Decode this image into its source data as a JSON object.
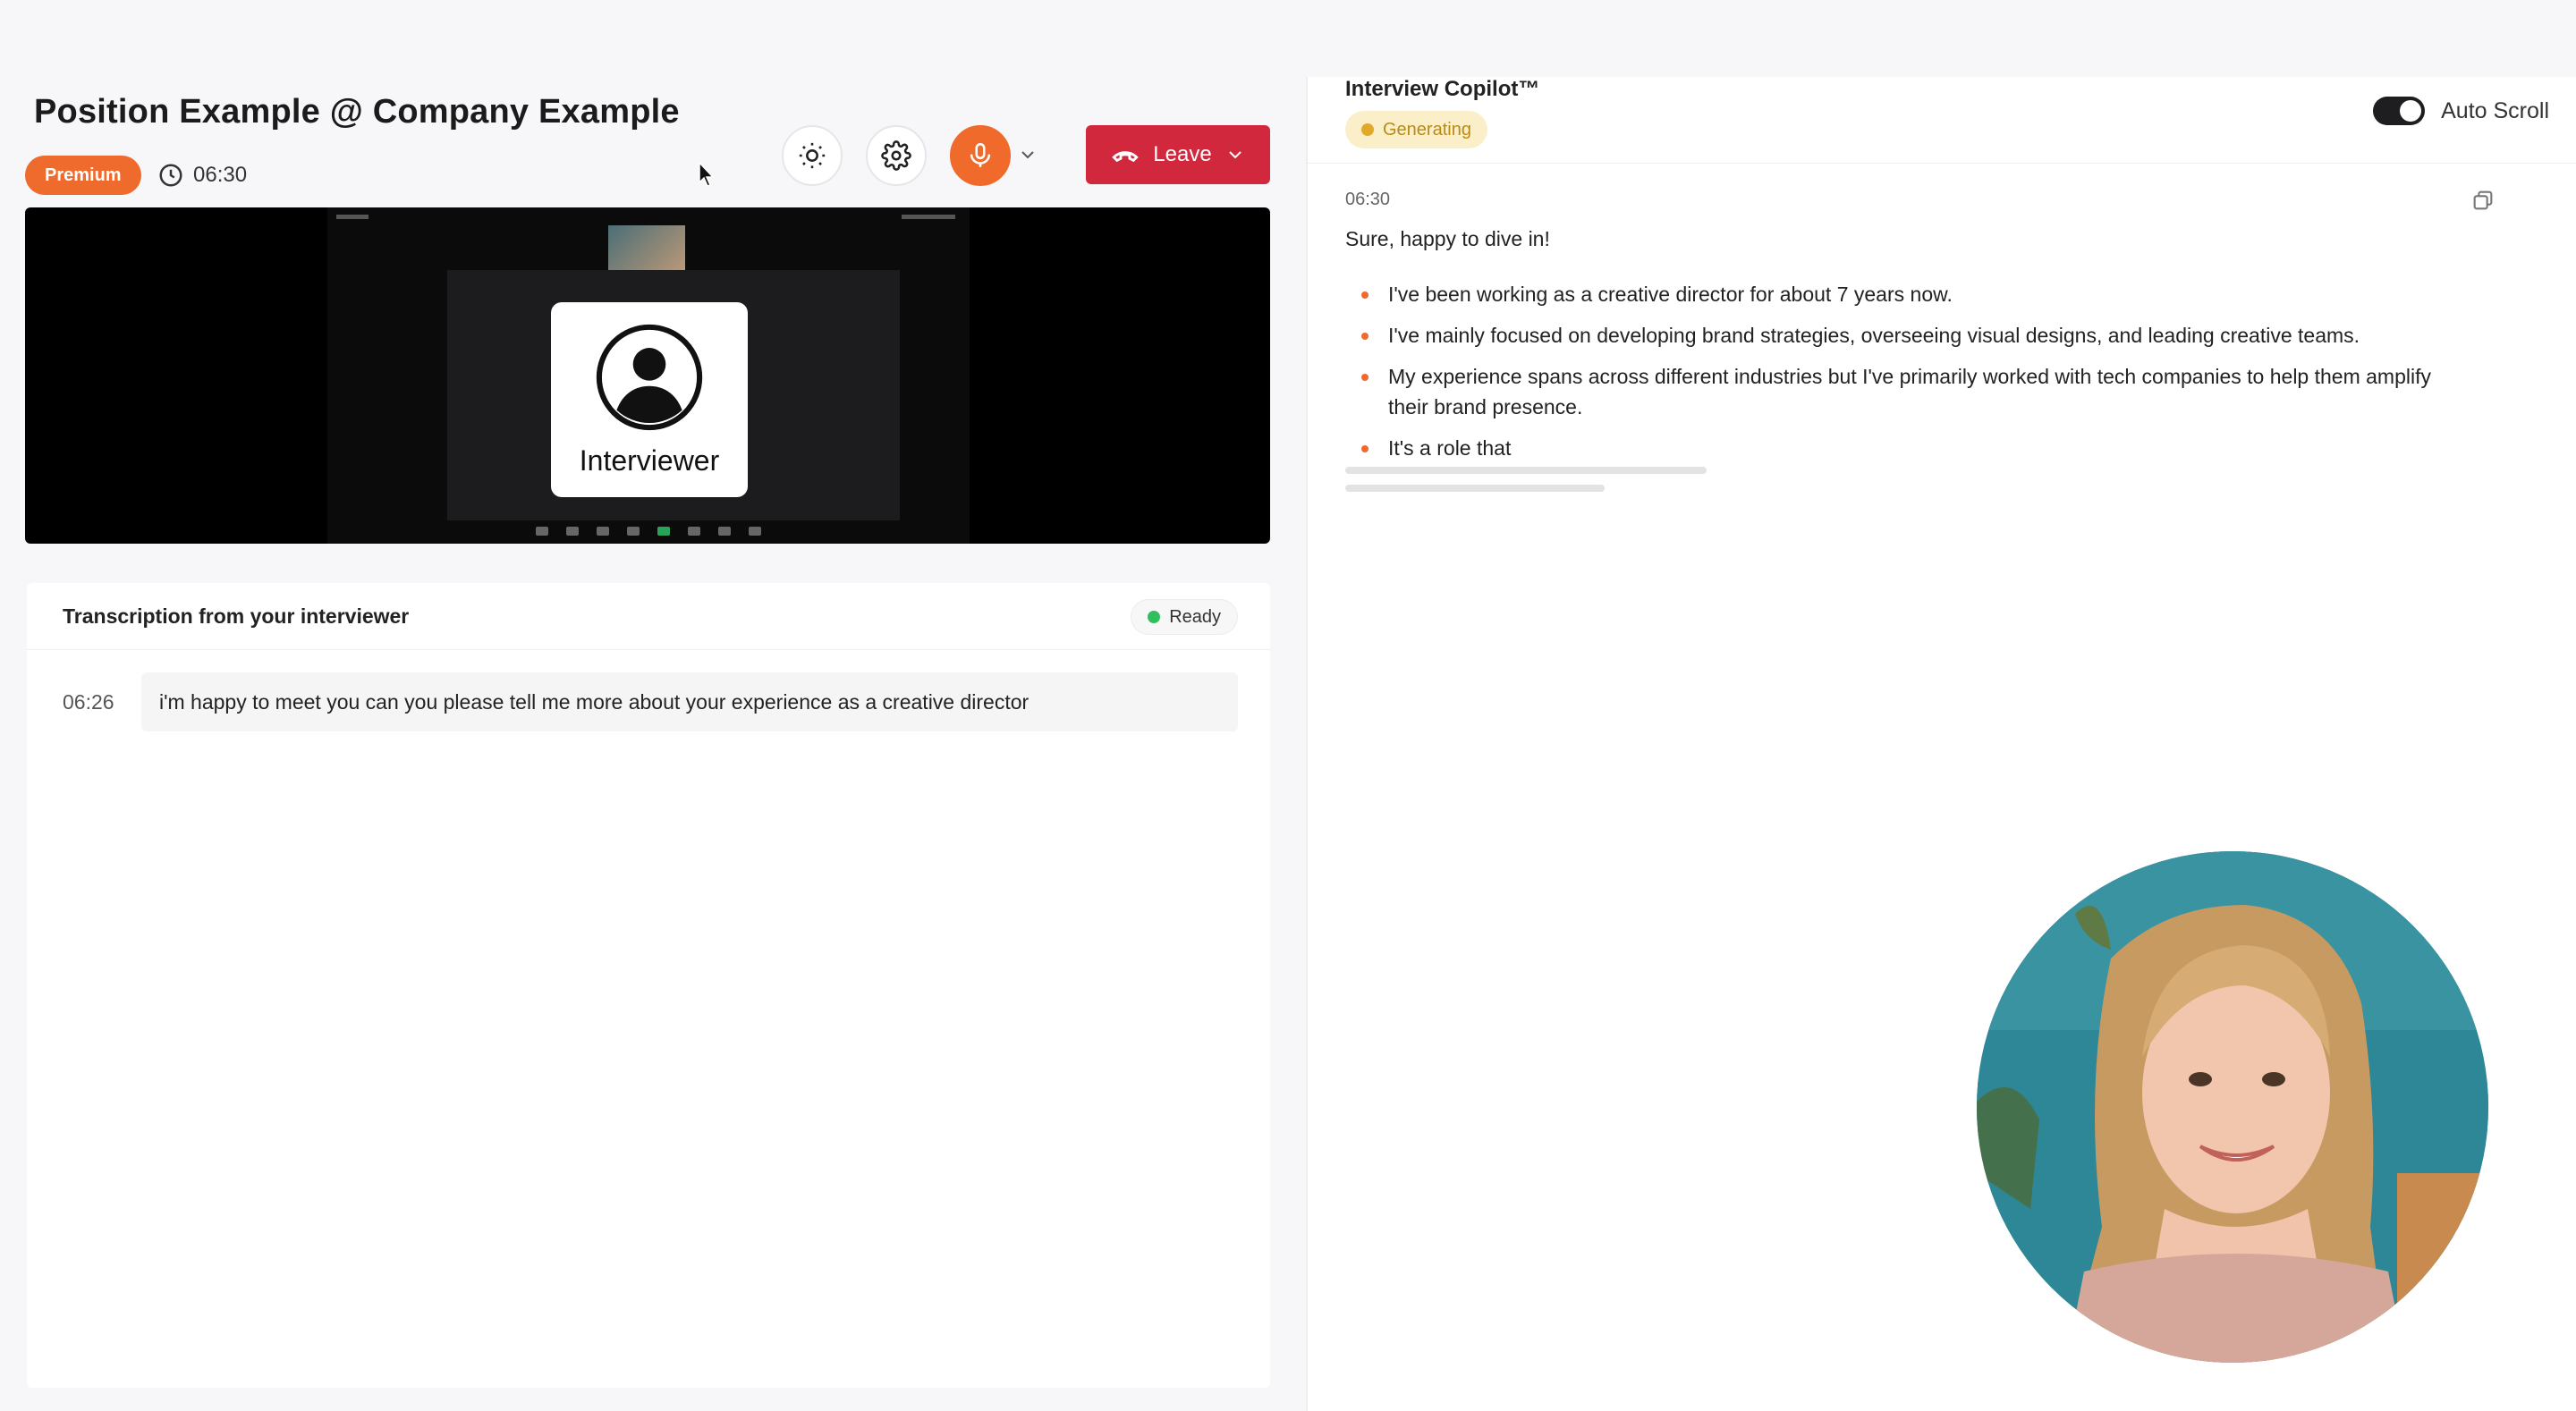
{
  "header": {
    "title": "Position Example @ Company Example",
    "plan_badge": "Premium",
    "timer": "06:30"
  },
  "toolbar": {
    "theme_icon": "sun-icon",
    "settings_icon": "gear-icon",
    "mic_icon": "microphone-icon",
    "leave_label": "Leave",
    "accent_color": "#ef6a2b",
    "leave_color": "#d2283d"
  },
  "video": {
    "participant_label": "Interviewer"
  },
  "transcription": {
    "title": "Transcription from your interviewer",
    "status": "Ready",
    "entries": [
      {
        "time": "06:26",
        "text": "i'm happy to meet you can you please tell me more about your experience as a creative director"
      }
    ]
  },
  "copilot": {
    "title": "Interview Copilot™",
    "status": "Generating",
    "auto_scroll_label": "Auto Scroll",
    "answer": {
      "time": "06:30",
      "intro": "Sure, happy to dive in!",
      "bullets": [
        "I've been working as a creative director for about 7 years now.",
        "I've mainly focused on developing brand strategies, overseeing visual designs, and leading creative teams.",
        "My experience spans across different industries but I've primarily worked with tech companies to help them amplify their brand presence.",
        "It's a role that"
      ]
    }
  }
}
